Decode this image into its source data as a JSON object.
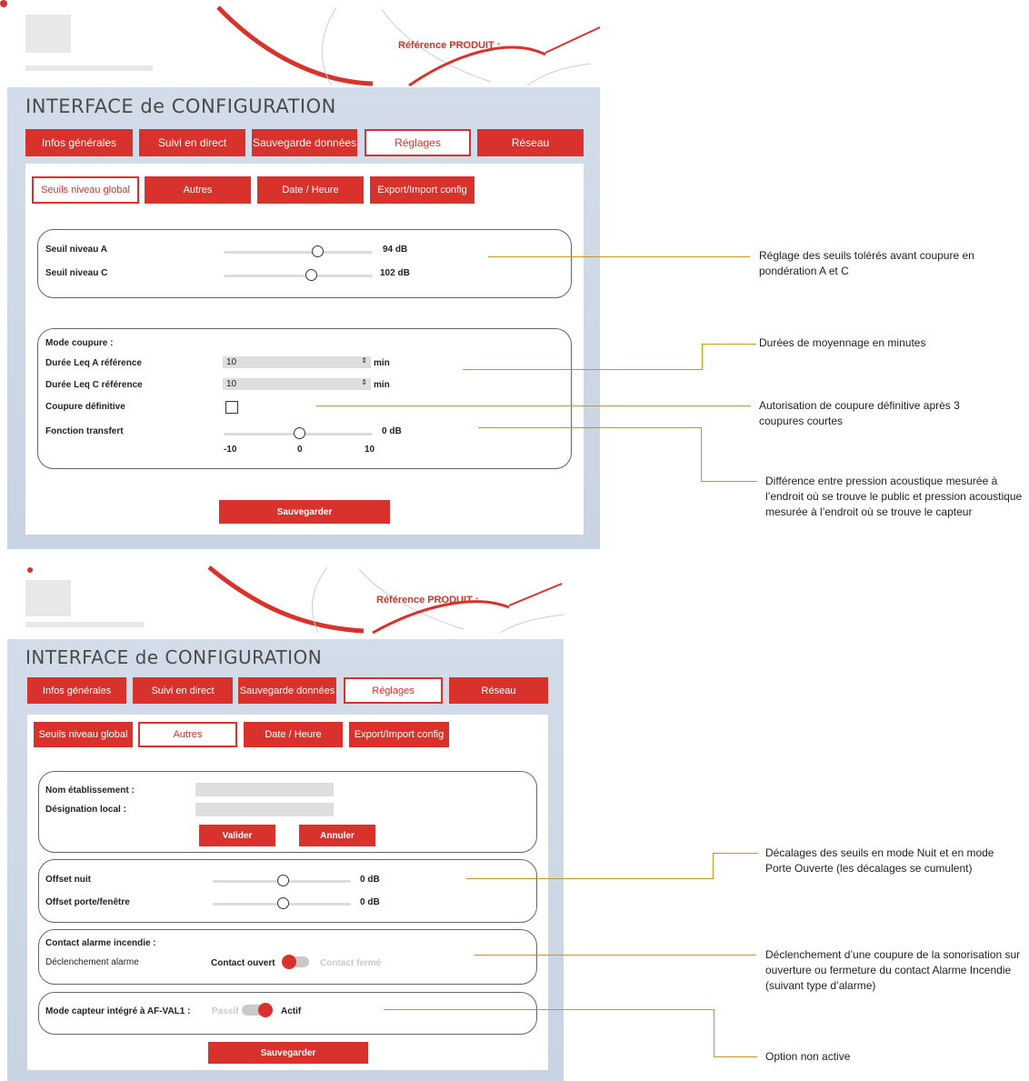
{
  "screen1": {
    "header": {
      "ref_label": "Référence PRODUIT :",
      "ref_value": ""
    },
    "title": "INTERFACE de CONFIGURATION",
    "main_tabs": [
      "Infos générales",
      "Suivi en direct",
      "Sauvegarde données",
      "Réglages",
      "Réseau"
    ],
    "active_main_tab": "Réglages",
    "sub_tabs": [
      "Seuils niveau global",
      "Autres",
      "Date / Heure",
      "Export/Import config"
    ],
    "active_sub_tab": "Seuils niveau global",
    "thresholds": {
      "level_a": {
        "label": "Seuil niveau A",
        "value": "94 dB",
        "position": 0.58
      },
      "level_c": {
        "label": "Seuil niveau C",
        "value": "102 dB",
        "position": 0.55
      }
    },
    "mode": {
      "title": "Mode coupure :",
      "leq_a": {
        "label": "Durée Leq A référence",
        "value": "10",
        "unit": "min"
      },
      "leq_c": {
        "label": "Durée Leq C référence",
        "value": "10",
        "unit": "min"
      },
      "definitive": {
        "label": "Coupure définitive",
        "checked": false
      },
      "transfer": {
        "label": "Fonction transfert",
        "value": "0 dB",
        "min": "-10",
        "mid": "0",
        "max": "10",
        "position": 0.5
      }
    },
    "save_label": "Sauvegarder"
  },
  "screen2": {
    "header": {
      "ref_label": "Référence PRODUIT :",
      "ref_value": ""
    },
    "title": "INTERFACE de CONFIGURATION",
    "main_tabs": [
      "Infos générales",
      "Suivi en direct",
      "Sauvegarde données",
      "Réglages",
      "Réseau"
    ],
    "active_main_tab": "Réglages",
    "sub_tabs": [
      "Seuils niveau global",
      "Autres",
      "Date / Heure",
      "Export/Import config"
    ],
    "active_sub_tab": "Autres",
    "establishment": {
      "name_label": "Nom établissement :",
      "name_value": "",
      "local_label": "Désignation local :",
      "local_value": "",
      "validate_label": "Valider",
      "cancel_label": "Annuler"
    },
    "offsets": {
      "night": {
        "label": "Offset nuit",
        "value": "0 dB",
        "position": 0.5
      },
      "door": {
        "label": "Offset porte/fenêtre",
        "value": "0 dB",
        "position": 0.5
      }
    },
    "alarm": {
      "title": "Contact alarme incendie :",
      "trigger_label": "Déclenchement alarme",
      "left_option": "Contact ouvert",
      "right_option": "Contact fermé",
      "selected": "Contact ouvert"
    },
    "sensor": {
      "label": "Mode capteur intégré à AF-VAL1 :",
      "off_option": "Passif",
      "on_option": "Actif",
      "selected": "Actif"
    },
    "save_label": "Sauvegarder"
  },
  "annotations": [
    "Réglage des seuils tolérés avant coupure en pondération A et C",
    "Durées de moyennage en minutes",
    "Autorisation de coupure définitive après 3 coupures courtes",
    "Différence entre pression acoustique mesurée à l’endroit où se trouve le public et pression acoustique mesurée à l’endroit où se trouve le capteur",
    "Décalages des seuils en mode Nuit et en mode Porte Ouverte (les décalages se cumulent)",
    "Déclenchement d’une coupure de la sonorisation sur ouverture ou fermeture du contact Alarme Incendie (suivant type d’alarme)",
    "Option non active"
  ],
  "colors": {
    "accent": "#d9312b",
    "panel": "#d3dde9",
    "leader": "#c8961a"
  }
}
